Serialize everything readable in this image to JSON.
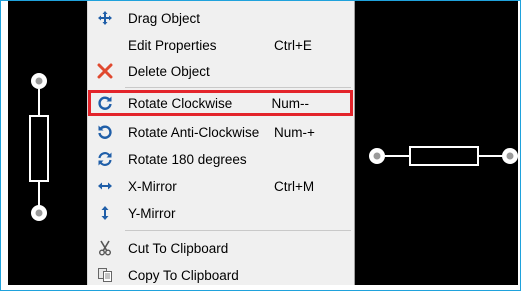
{
  "menu": {
    "items": [
      {
        "label": "Drag Object",
        "shortcut": ""
      },
      {
        "label": "Edit Properties",
        "shortcut": "Ctrl+E"
      },
      {
        "label": "Delete Object",
        "shortcut": ""
      },
      {
        "label": "Rotate Clockwise",
        "shortcut": "Num--"
      },
      {
        "label": "Rotate Anti-Clockwise",
        "shortcut": "Num-+"
      },
      {
        "label": "Rotate 180 degrees",
        "shortcut": ""
      },
      {
        "label": "X-Mirror",
        "shortcut": "Ctrl+M"
      },
      {
        "label": "Y-Mirror",
        "shortcut": ""
      },
      {
        "label": "Cut To Clipboard",
        "shortcut": ""
      },
      {
        "label": "Copy To Clipboard",
        "shortcut": ""
      }
    ]
  },
  "colors": {
    "canvas_bg": "#000000",
    "menu_bg": "#f0f0f0",
    "highlight_border": "#e3242b",
    "component_stroke": "#ffffff",
    "frame_border": "#1fa2dc",
    "icon_blue": "#1f5ea8",
    "delete_red": "#e0492f"
  },
  "icons": [
    "move-icon",
    "delete-icon",
    "rotate-cw-icon",
    "rotate-ccw-icon",
    "rotate-180-icon",
    "x-mirror-icon",
    "y-mirror-icon",
    "scissors-icon",
    "copy-icon"
  ]
}
